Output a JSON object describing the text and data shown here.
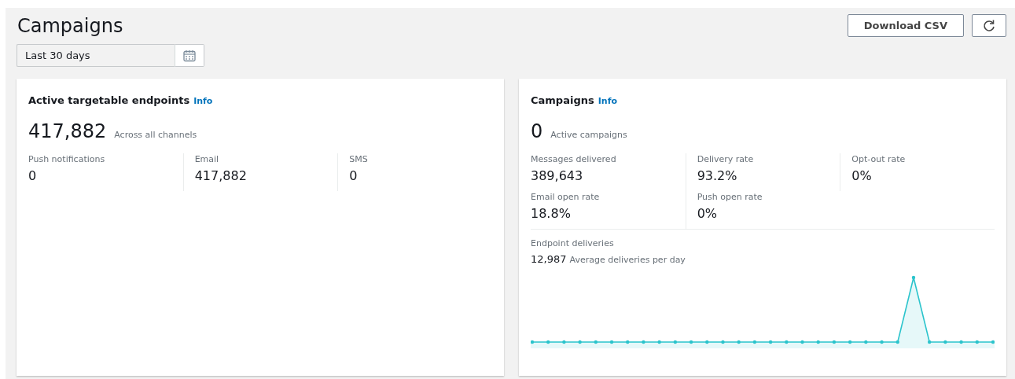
{
  "page_title": "Campaigns",
  "date_range": {
    "value": "Last 30 days"
  },
  "buttons": [
    "Download CSV"
  ],
  "endpoints_card": {
    "title": "Active targetable endpoints",
    "info": "Info",
    "total": "417,882",
    "total_label": "Across all channels",
    "metrics": [
      {
        "label": "Push notifications",
        "value": "0"
      },
      {
        "label": "Email",
        "value": "417,882"
      },
      {
        "label": "SMS",
        "value": "0"
      }
    ]
  },
  "campaigns_card": {
    "title": "Campaigns",
    "info": "Info",
    "total": "0",
    "total_label": "Active campaigns",
    "metrics": [
      {
        "label": "Messages delivered",
        "value": "389,643"
      },
      {
        "label": "Delivery rate",
        "value": "93.2%"
      },
      {
        "label": "Opt-out rate",
        "value": "0%"
      },
      {
        "label": "Email open rate",
        "value": "18.8%"
      },
      {
        "label": "Push open rate",
        "value": "0%"
      }
    ],
    "deliveries": {
      "title": "Endpoint deliveries",
      "value": "12,987",
      "value_label": "Average deliveries per day"
    }
  }
}
